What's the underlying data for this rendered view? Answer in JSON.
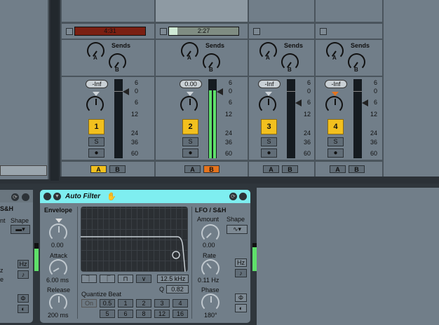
{
  "channels": [
    {
      "clip_time": "4:31",
      "clip_color": "#7a1f12",
      "volume": "-Inf",
      "track": "1",
      "solo": "S",
      "crossfade_active": "A",
      "meter_level": 0,
      "fader_db": 0,
      "wide": true
    },
    {
      "clip_time": "2:27",
      "clip_color": "#7f8c82",
      "volume": "0.00",
      "track": "2",
      "solo": "S",
      "crossfade_active": "B",
      "meter_level": 0.86,
      "fader_db": 0,
      "wide": true,
      "playing": true
    },
    {
      "clip_time": "",
      "clip_color": "",
      "volume": "-Inf",
      "track": "3",
      "solo": "S",
      "crossfade_active": "",
      "meter_level": 0,
      "fader_db": 6,
      "wide": false
    },
    {
      "clip_time": "",
      "clip_color": "",
      "volume": "-Inf",
      "track": "4",
      "solo": "S",
      "crossfade_active": "",
      "meter_level": 0,
      "fader_db": 6,
      "wide": false,
      "pan_modulated": true
    }
  ],
  "sends_label": "Sends",
  "send_a": "A",
  "send_b": "B",
  "xfade_a": "A",
  "xfade_b": "B",
  "scale": [
    "6",
    "0",
    "6",
    "12",
    "24",
    "36",
    "60"
  ],
  "colors": {
    "track_button": "#f2c01e",
    "crossfade_a": "#f2c01e",
    "crossfade_b": "#e4731d",
    "device_title": "#7eeef0",
    "meter_green": "#5fe06a"
  },
  "left_device": {
    "section": "S&H",
    "amount": "nt",
    "shape": "Shape",
    "hz": "Hz",
    "sync": "♪",
    "phase": "Φ",
    "offset": "◐",
    "z": "z",
    "e": "e"
  },
  "auto_filter": {
    "title": "Auto Filter",
    "envelope": {
      "label": "Envelope",
      "amount": "0.00",
      "attack_label": "Attack",
      "attack": "6.00 ms",
      "release_label": "Release",
      "release": "200 ms"
    },
    "frequency": "12.5 kHz",
    "q_label": "Q",
    "q": "0.82",
    "filter_types": [
      "lowpass",
      "highpass",
      "bandpass",
      "notch"
    ],
    "quantize_label": "Quantize Beat",
    "quantize_on": "On",
    "quantize_values": [
      "0.5",
      "1",
      "2",
      "3",
      "4",
      "5",
      "6",
      "8",
      "12",
      "16"
    ],
    "lfo": {
      "label": "LFO / S&H",
      "amount_label": "Amount",
      "amount": "0.00",
      "shape_label": "Shape",
      "rate_label": "Rate",
      "rate": "0.11 Hz",
      "phase_label": "Phase",
      "phase": "180°",
      "hz": "Hz",
      "sync": "♪",
      "phase_btn": "Φ",
      "offset_btn": "◐"
    }
  }
}
